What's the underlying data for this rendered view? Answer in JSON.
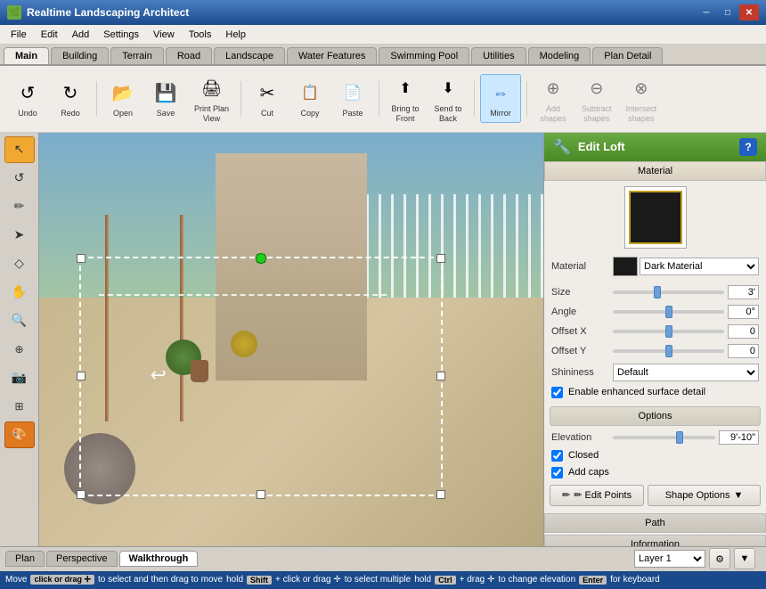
{
  "app": {
    "title": "Realtime Landscaping Architect",
    "icon": "🌿"
  },
  "titlebar": {
    "minimize": "─",
    "maximize": "□",
    "close": "✕"
  },
  "menubar": {
    "items": [
      "File",
      "Edit",
      "Add",
      "Settings",
      "View",
      "Tools",
      "Help"
    ]
  },
  "tabs": {
    "items": [
      "Main",
      "Building",
      "Terrain",
      "Road",
      "Landscape",
      "Water Features",
      "Swimming Pool",
      "Utilities",
      "Modeling",
      "Plan Detail"
    ],
    "active": "Main"
  },
  "toolbar": {
    "buttons": [
      {
        "id": "undo",
        "label": "Undo",
        "icon": "↺",
        "disabled": false
      },
      {
        "id": "redo",
        "label": "Redo",
        "icon": "↻",
        "disabled": false
      },
      {
        "id": "open",
        "label": "Open",
        "icon": "📂",
        "disabled": false
      },
      {
        "id": "save",
        "label": "Save",
        "icon": "💾",
        "disabled": false
      },
      {
        "id": "print",
        "label": "Print Plan\nView",
        "icon": "🖨",
        "disabled": false
      },
      {
        "id": "cut",
        "label": "Cut",
        "icon": "✂",
        "disabled": false
      },
      {
        "id": "copy",
        "label": "Copy",
        "icon": "📋",
        "disabled": false
      },
      {
        "id": "paste",
        "label": "Paste",
        "icon": "📌",
        "disabled": false
      },
      {
        "id": "bring-front",
        "label": "Bring to\nFront",
        "icon": "⬆",
        "disabled": false
      },
      {
        "id": "send-back",
        "label": "Send to\nBack",
        "icon": "⬇",
        "disabled": false
      },
      {
        "id": "mirror",
        "label": "Mirror",
        "icon": "⇔",
        "disabled": false,
        "active": true
      },
      {
        "id": "add-shapes",
        "label": "Add\nshapes",
        "icon": "⊕",
        "disabled": true
      },
      {
        "id": "subtract-shapes",
        "label": "Subtract\nshapes",
        "icon": "⊖",
        "disabled": true
      },
      {
        "id": "intersect-shapes",
        "label": "Intersect\nshapes",
        "icon": "⊗",
        "disabled": true
      }
    ]
  },
  "left_tools": [
    {
      "id": "select",
      "icon": "↖",
      "active": true
    },
    {
      "id": "undo-tool",
      "icon": "↺"
    },
    {
      "id": "pencil",
      "icon": "✏"
    },
    {
      "id": "pointer",
      "icon": "➤"
    },
    {
      "id": "shape",
      "icon": "◇"
    },
    {
      "id": "hand",
      "icon": "✋"
    },
    {
      "id": "zoom",
      "icon": "🔍"
    },
    {
      "id": "measure",
      "icon": "⊕"
    },
    {
      "id": "camera",
      "icon": "📷"
    },
    {
      "id": "grid",
      "icon": "⊞"
    },
    {
      "id": "color",
      "icon": "🎨"
    }
  ],
  "panel": {
    "title": "Edit Loft",
    "icon": "🔧",
    "help": "?",
    "section_material": "Material",
    "material": {
      "label": "Material",
      "color": "#1a1a1a"
    },
    "size": {
      "label": "Size",
      "value": "3'"
    },
    "angle": {
      "label": "Angle",
      "value": "0°"
    },
    "offset_x": {
      "label": "Offset X",
      "value": "0"
    },
    "offset_y": {
      "label": "Offset Y",
      "value": "0"
    },
    "shininess": {
      "label": "Shininess",
      "value": "Default"
    },
    "enhance_label": "Enable enhanced surface detail",
    "section_options": "Options",
    "elevation": {
      "label": "Elevation",
      "value": "9'-10\""
    },
    "closed_label": "Closed",
    "add_caps_label": "Add caps",
    "edit_points_label": "✏ Edit Points",
    "shape_options_label": "Shape Options",
    "path_tab": "Path",
    "info_tab": "Information"
  },
  "bottom_bar": {
    "view_tabs": [
      "Plan",
      "Perspective",
      "Walkthrough"
    ],
    "active_view": "Walkthrough",
    "layer_label": "Layer 1"
  },
  "status": {
    "action": "Move",
    "tip1": "click or drag",
    "move_icon": "✛",
    "tip2": "to select and then drag to move",
    "tip3": "hold",
    "shift_key": "Shift",
    "tip4": "+ click or drag",
    "shift_icon": "✛",
    "tip5": "to select multiple",
    "tip6": "hold",
    "ctrl_key": "Ctrl",
    "tip7": "+ drag",
    "ctrl_icon": "✛",
    "tip8": "to change elevation",
    "enter_key": "Enter",
    "tip9": "for keyboard"
  }
}
